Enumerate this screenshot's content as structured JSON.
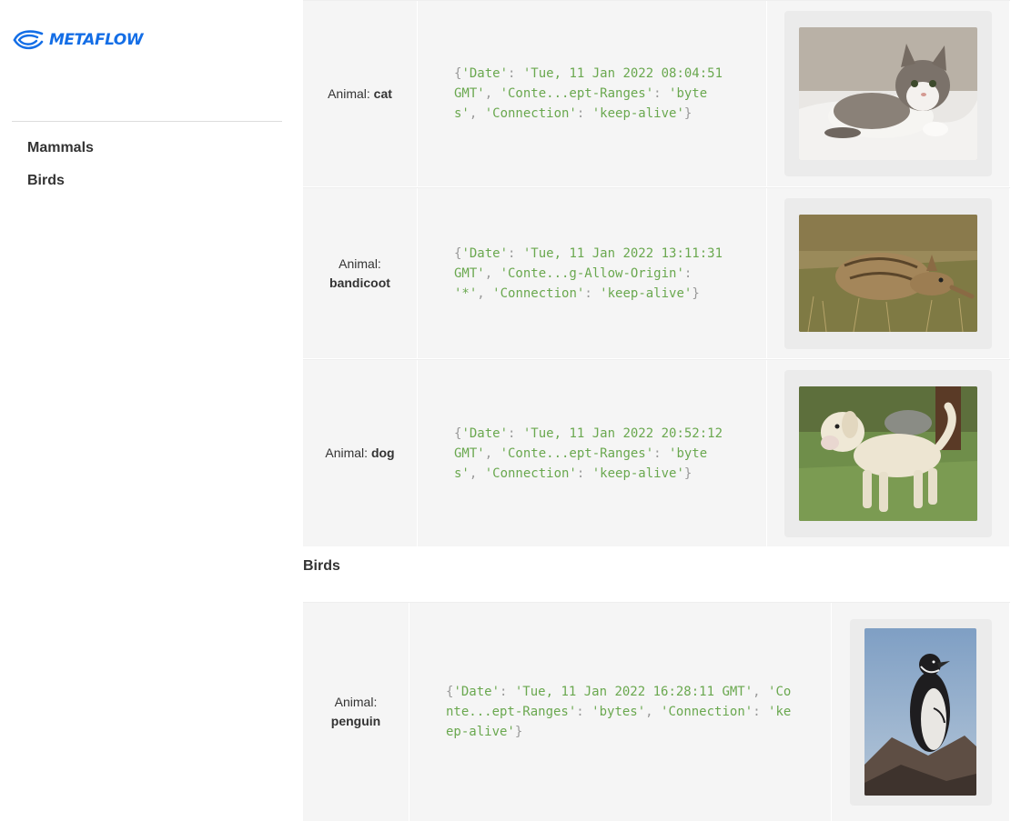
{
  "brand": {
    "name": "METAFLOW",
    "color": "#146ee6"
  },
  "nav": {
    "items": [
      {
        "label": "Mammals"
      },
      {
        "label": "Birds"
      }
    ]
  },
  "sections": {
    "birds_heading": "Birds"
  },
  "rows": [
    {
      "animal_label": "Animal:",
      "animal": "cat",
      "headers_text": "{'Date': 'Tue, 11 Jan 2022 08:04:51 GMT', 'Conte...ept-Ranges': 'bytes', 'Connection': 'keep-alive'}",
      "image": "cat-photo"
    },
    {
      "animal_label": "Animal:",
      "animal": "bandicoot",
      "headers_text": "{'Date': 'Tue, 11 Jan 2022 13:11:31 GMT', 'Conte...g-Allow-Origin': '*', 'Connection': 'keep-alive'}",
      "image": "bandicoot-photo"
    },
    {
      "animal_label": "Animal:",
      "animal": "dog",
      "headers_text": "{'Date': 'Tue, 11 Jan 2022 20:52:12 GMT', 'Conte...ept-Ranges': 'bytes', 'Connection': 'keep-alive'}",
      "image": "dog-photo"
    },
    {
      "animal_label": "Animal:",
      "animal": "penguin",
      "headers_text": "{'Date': 'Tue, 11 Jan 2022 16:28:11 GMT', 'Conte...ept-Ranges': 'bytes', 'Connection': 'keep-alive'}",
      "image": "penguin-photo"
    }
  ],
  "colors": {
    "code_string": "#6aa84f",
    "code_punct": "#999999",
    "cell_bg": "#f5f5f5",
    "image_card_bg": "#ebebeb"
  }
}
